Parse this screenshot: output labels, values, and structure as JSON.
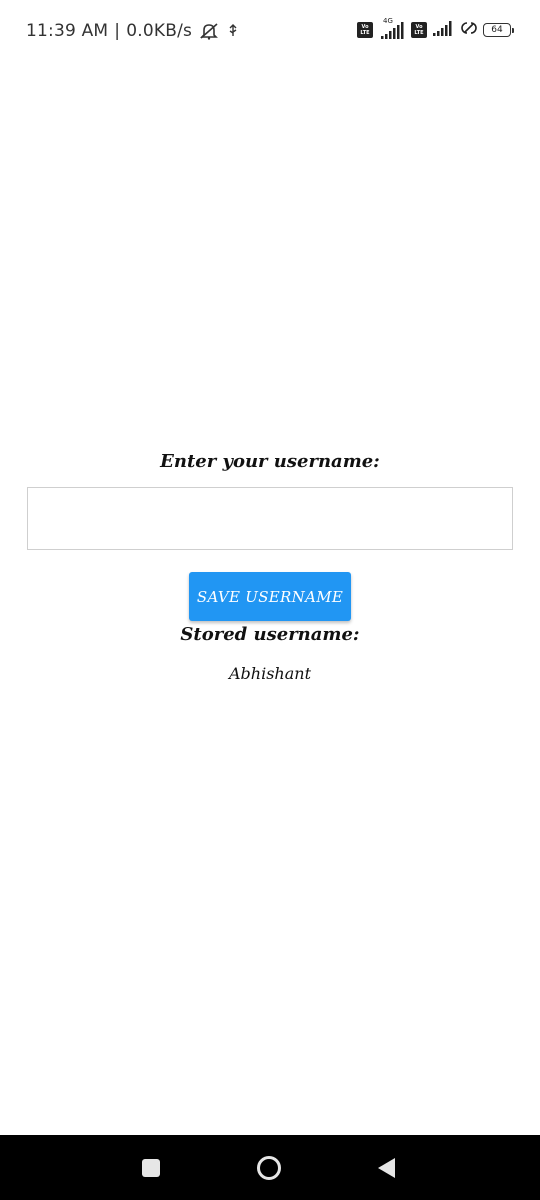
{
  "status_bar": {
    "time": "11:39 AM",
    "separator": "|",
    "speed": "0.0KB/s",
    "network_type": "4G",
    "volte_label_1": "Vo",
    "volte_label_2": "LTE",
    "battery_level": "64"
  },
  "form": {
    "prompt_label": "Enter your username:",
    "input_value": "",
    "input_placeholder": "",
    "save_button_label": "SAVE USERNAME",
    "stored_label": "Stored username:",
    "stored_value": "Abhishant"
  },
  "colors": {
    "button_bg": "#2196f3",
    "nav_bar_bg": "#000000",
    "input_border": "#cfcfcf"
  },
  "nav_bar": {
    "icons": [
      "recents-icon",
      "home-icon",
      "back-icon"
    ]
  }
}
